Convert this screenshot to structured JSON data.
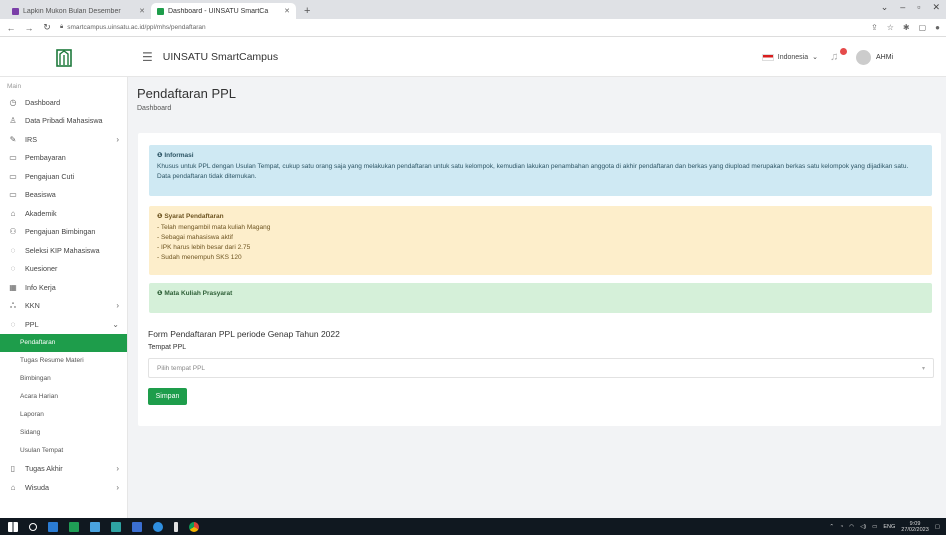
{
  "browser": {
    "tabs": [
      {
        "title": "Lapkin Mukon Bulan Desember",
        "favicon_color": "#7b3fa8",
        "active": false
      },
      {
        "title": "Dashboard - UINSATU SmartCa",
        "favicon_color": "#1e9d4b",
        "active": true
      }
    ],
    "new_tab": "+",
    "url": "smartcampus.uinsatu.ac.id/ppl/mhs/pendaftaran"
  },
  "header": {
    "app_title": "UINSATU SmartCampus",
    "language": "Indonesia",
    "user_name": "AHMi"
  },
  "sidebar": {
    "section": "Main",
    "items": [
      {
        "label": "Dashboard",
        "icon": "clock-icon",
        "glyph": "◷"
      },
      {
        "label": "Data Pribadi Mahasiswa",
        "icon": "user-icon",
        "glyph": "♙"
      },
      {
        "label": "IRS",
        "icon": "edit-icon",
        "glyph": "✎",
        "chevron": "›"
      },
      {
        "label": "Pembayaran",
        "icon": "card-icon",
        "glyph": "▭"
      },
      {
        "label": "Pengajuan Cuti",
        "icon": "card-icon",
        "glyph": "▭"
      },
      {
        "label": "Beasiswa",
        "icon": "card-icon",
        "glyph": "▭"
      },
      {
        "label": "Akademik",
        "icon": "mortarboard-icon",
        "glyph": "⌂"
      },
      {
        "label": "Pengajuan Bimbingan",
        "icon": "group-icon",
        "glyph": "⚇"
      },
      {
        "label": "Seleksi KIP Mahasiswa",
        "icon": "circle-icon",
        "glyph": "◌"
      },
      {
        "label": "Kuesioner",
        "icon": "circle-icon",
        "glyph": "◌"
      },
      {
        "label": "Info Kerja",
        "icon": "calendar-icon",
        "glyph": "▦"
      },
      {
        "label": "KKN",
        "icon": "people-icon",
        "glyph": "ஃ",
        "chevron": "›"
      },
      {
        "label": "PPL",
        "icon": "circle-icon",
        "glyph": "◌",
        "chevron": "⌄"
      }
    ],
    "ppl_sub": [
      {
        "label": "Pendaftaran",
        "active": true
      },
      {
        "label": "Tugas Resume Materi"
      },
      {
        "label": "Bimbingan"
      },
      {
        "label": "Acara Harian"
      },
      {
        "label": "Laporan"
      },
      {
        "label": "Sidang"
      },
      {
        "label": "Usulan Tempat"
      }
    ],
    "items_after": [
      {
        "label": "Tugas Akhir",
        "icon": "book-icon",
        "glyph": "▯",
        "chevron": "›"
      },
      {
        "label": "Wisuda",
        "icon": "mortarboard-icon",
        "glyph": "⌂",
        "chevron": "›"
      }
    ]
  },
  "main": {
    "page_title": "Pendaftaran PPL",
    "breadcrumb": "Dashboard",
    "info": {
      "title": "Informasi",
      "text": "Khusus untuk PPL dengan Usulan Tempat, cukup satu orang saja yang melakukan pendaftaran untuk satu kelompok, kemudian lakukan penambahan anggota di akhir pendaftaran dan berkas yang diupload merupakan berkas satu kelompok yang dijadikan satu.",
      "note": "Data pendaftaran tidak ditemukan."
    },
    "syarat": {
      "title": "Syarat Pendaftaran",
      "items": [
        "- Telah mengambil mata kuliah Magang",
        "- Sebagai mahasiswa aktif",
        "- IPK harus lebih besar dari 2.75",
        "- Sudah menempuh SKS 120"
      ]
    },
    "prasyarat": {
      "title": "Mata Kuliah Prasyarat"
    },
    "form": {
      "title": "Form Pendaftaran PPL periode Genap Tahun 2022",
      "label": "Tempat PPL",
      "placeholder": "Pilih tempat PPL",
      "save": "Simpan"
    }
  },
  "taskbar": {
    "lang": "ENG",
    "time": "9:09",
    "date": "27/02/2023"
  },
  "colors": {
    "brand_green": "#1e9d4b",
    "info_bg": "#cfe9f3",
    "warn_bg": "#fdeecb",
    "ok_bg": "#d5f0d9"
  }
}
